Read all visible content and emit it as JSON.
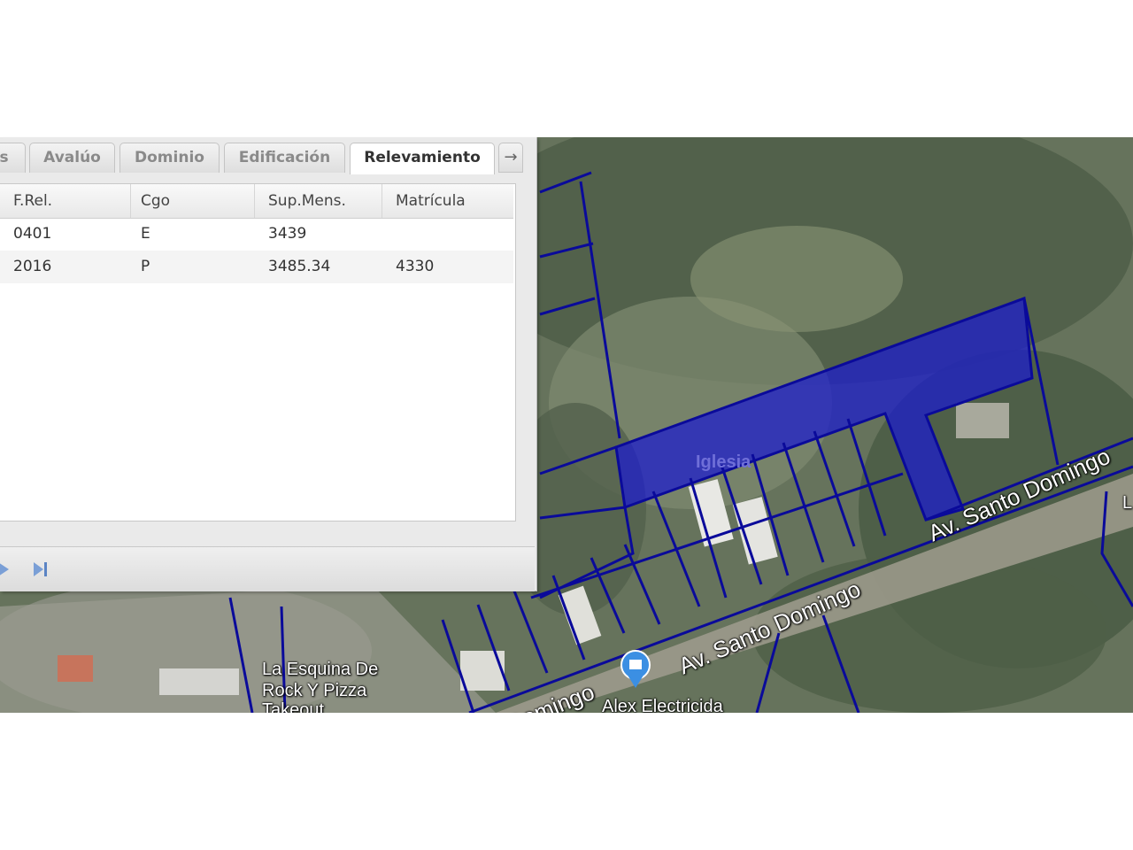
{
  "panel": {
    "tabs": [
      {
        "label": "s",
        "active": false
      },
      {
        "label": "Avalúo",
        "active": false
      },
      {
        "label": "Dominio",
        "active": false
      },
      {
        "label": "Edificación",
        "active": false
      },
      {
        "label": "Relevamiento",
        "active": true
      }
    ],
    "scroll_icon": "arrow-right-icon",
    "table": {
      "columns": [
        "F.Rel.",
        "Cgo",
        "Sup.Mens.",
        "Matrícula"
      ],
      "rows": [
        {
          "frel": "0401",
          "cgo": "E",
          "sup": "3439",
          "matricula": ""
        },
        {
          "frel": "2016",
          "cgo": "P",
          "sup": "3485.34",
          "matricula": "4330"
        }
      ]
    },
    "pager": {
      "next_icon": "next-page-icon",
      "last_icon": "last-page-icon"
    }
  },
  "map": {
    "streets": [
      "Av. Santo Domingo",
      "Av. Santo Domingo",
      "Domingo"
    ],
    "places": [
      "La Esquina De",
      "Rock Y Pizza",
      "Takeout",
      "Alex Electricida",
      "Iglesia",
      "L"
    ],
    "highlight_color": "#1a1ad0",
    "parcel_line_color": "#0a0a9a"
  }
}
